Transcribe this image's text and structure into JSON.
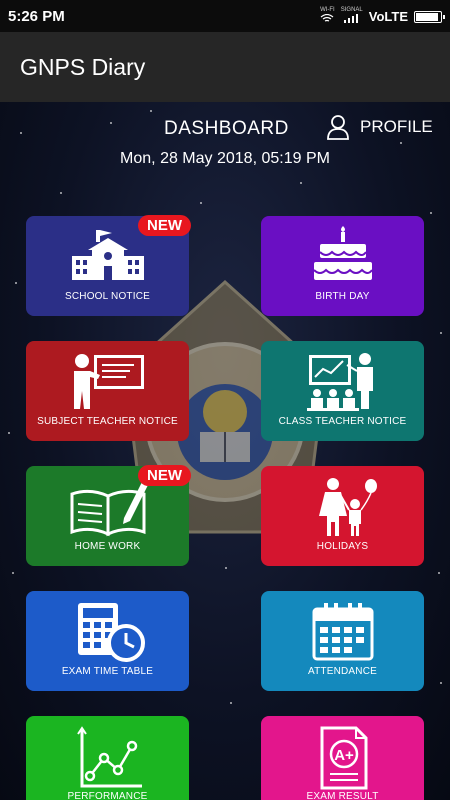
{
  "status_bar": {
    "time": "5:26 PM",
    "wifi_label": "WI-FI",
    "signal_label": "SIGNAL",
    "network": "VoLTE",
    "battery_level": 0.85
  },
  "app_bar": {
    "title": "GNPS Diary"
  },
  "header": {
    "dashboard_label": "DASHBOARD",
    "profile_label": "PROFILE",
    "datetime": "Mon, 28 May 2018, 05:19 PM"
  },
  "tiles": [
    {
      "label": "SCHOOL NOTICE",
      "color": "#2b2f87",
      "icon": "school-icon",
      "badge": "NEW"
    },
    {
      "label": "BIRTH DAY",
      "color": "#6a0fc3",
      "icon": "cake-icon"
    },
    {
      "label": "SUBJECT TEACHER NOTICE",
      "color": "#ad1a20",
      "icon": "teacher-board-icon"
    },
    {
      "label": "CLASS TEACHER NOTICE",
      "color": "#0e7670",
      "icon": "class-presentation-icon"
    },
    {
      "label": "HOME WORK",
      "color": "#1c7a29",
      "icon": "book-pencil-icon",
      "badge": "NEW"
    },
    {
      "label": "HOLIDAYS",
      "color": "#d4152f",
      "icon": "family-balloon-icon"
    },
    {
      "label": "EXAM TIME TABLE",
      "color": "#1d5bc9",
      "icon": "calculator-clock-icon"
    },
    {
      "label": "ATTENDANCE",
      "color": "#1489bd",
      "icon": "calendar-icon"
    },
    {
      "label": "PERFORMANCE",
      "color": "#1bb521",
      "icon": "line-graph-icon"
    },
    {
      "label": "EXAM RESULT",
      "color": "#e3168c",
      "icon": "grade-report-icon"
    }
  ]
}
